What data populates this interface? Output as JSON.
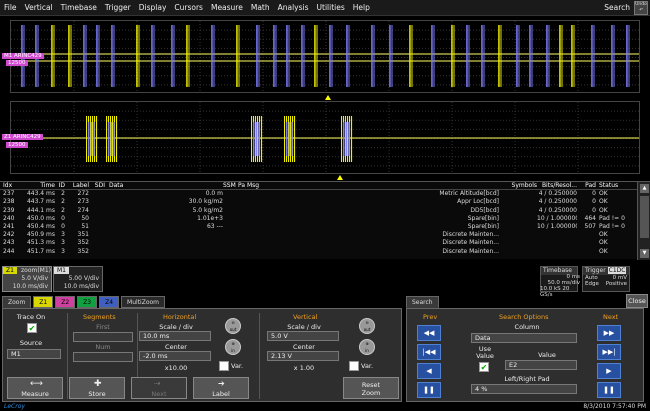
{
  "menu": [
    "File",
    "Vertical",
    "Timebase",
    "Trigger",
    "Display",
    "Cursors",
    "Measure",
    "Math",
    "Analysis",
    "Utilities",
    "Help"
  ],
  "search_label": "Search",
  "undo_label": "Undo",
  "trace1_label": "M1 ARINC429",
  "trace1_badge": "12500",
  "trace2_label": "Z1 ARINC429",
  "trace2_badge": "12500",
  "table": {
    "headers": [
      "Idx",
      "Time",
      "ID",
      "Label",
      "SDI",
      "Data",
      "",
      "SSM",
      "Pa",
      "Msg",
      "Symbols",
      "Bits/Resol...",
      "Pad",
      "Status"
    ],
    "rows": [
      [
        "237",
        "443.4 ms",
        "2",
        "272",
        "",
        "",
        "0.0 m",
        "",
        "",
        "Metric Altitude[bcd]",
        "",
        "4 / 0.250000",
        "0",
        "OK"
      ],
      [
        "238",
        "443.7 ms",
        "2",
        "273",
        "",
        "",
        "30.0 kg/m2",
        "",
        "",
        "Appr Loc[bcd]",
        "",
        "4 / 0.250000",
        "0",
        "OK"
      ],
      [
        "239",
        "444.1 ms",
        "2",
        "274",
        "",
        "",
        "5.0 kg/m2",
        "",
        "",
        "DD5[bcd]",
        "",
        "4 / 0.250000",
        "0",
        "OK"
      ],
      [
        "240",
        "450.0 ms",
        "0",
        "50",
        "",
        "",
        "1.01e+3",
        "",
        "",
        "Spare[bin]",
        "",
        "10 / 1.000000",
        "464",
        "Pad != 0"
      ],
      [
        "241",
        "450.4 ms",
        "0",
        "51",
        "",
        "",
        "63 ---",
        "",
        "",
        "Spare[bin]",
        "",
        "10 / 1.000000",
        "507",
        "Pad != 0"
      ],
      [
        "242",
        "450.9 ms",
        "3",
        "351",
        "",
        "",
        "",
        "",
        "",
        "Discrete Mainten...",
        "",
        "",
        "",
        "OK"
      ],
      [
        "243",
        "451.3 ms",
        "3",
        "352",
        "",
        "",
        "",
        "",
        "",
        "Discrete Mainten...",
        "",
        "",
        "",
        "OK"
      ],
      [
        "244",
        "451.7 ms",
        "3",
        "352",
        "",
        "",
        "",
        "",
        "",
        "Discrete Mainten...",
        "",
        "",
        "",
        "OK"
      ]
    ]
  },
  "z1_desc": {
    "tag": "Z1",
    "name": "zoom(M1)",
    "v1": "5.0 V/div",
    "v2": "10.0 ms/div"
  },
  "m1_desc": {
    "tag": "M1",
    "v1": "5.00 V/div",
    "v2": "10.0 ms/div"
  },
  "timebase": {
    "title": "Timebase",
    "offset": "0 ms",
    "div": "50.0 ms/div",
    "rate": "10.0 kS",
    "srate": "20 GS/s"
  },
  "trigger": {
    "title": "Trigger",
    "ch": "C1DC",
    "mode": "Auto",
    "level": "0 mV",
    "type": "Edge",
    "slope": "Positive"
  },
  "tabs": [
    "Zoom",
    "Z1",
    "Z2",
    "Z3",
    "Z4",
    "MultiZoom"
  ],
  "search_tab": "Search",
  "close_btn": "Close",
  "zoom_panel": {
    "trace_on": "Trace On",
    "source": "Source",
    "source_val": "M1",
    "segments": "Segments",
    "first": "First",
    "num": "Num",
    "horizontal": "Horizontal",
    "scale_div": "Scale / div",
    "h_scale": "10.0 ms",
    "center": "Center",
    "h_center": "-2.0 ms",
    "h_factor": "x10.00",
    "var": "Var.",
    "vertical": "Vertical",
    "v_scale": "5.0 V",
    "v_center": "2.13 V",
    "v_factor": "x 1.00",
    "out": "out",
    "in": "in",
    "measure": "Measure",
    "store": "Store",
    "next": "Next",
    "label": "Label",
    "reset_zoom_1": "Reset",
    "reset_zoom_2": "Zoom"
  },
  "search_panel": {
    "prev": "Prev",
    "next": "Next",
    "options": "Search Options",
    "column": "Column",
    "column_val": "Data",
    "use_value_1": "Use",
    "use_value_2": "Value",
    "value": "Value",
    "value_val": "E2",
    "lr_pad": "Left/Right Pad",
    "lr_pad_val": "4 %"
  },
  "status": {
    "logo": "LeCroy",
    "datetime": "8/3/2010 7:57:40 PM"
  },
  "colors": {
    "trace_blue": "#8080ff",
    "trace_yellow": "#f0f000",
    "accent_orange": "#f0a020"
  }
}
